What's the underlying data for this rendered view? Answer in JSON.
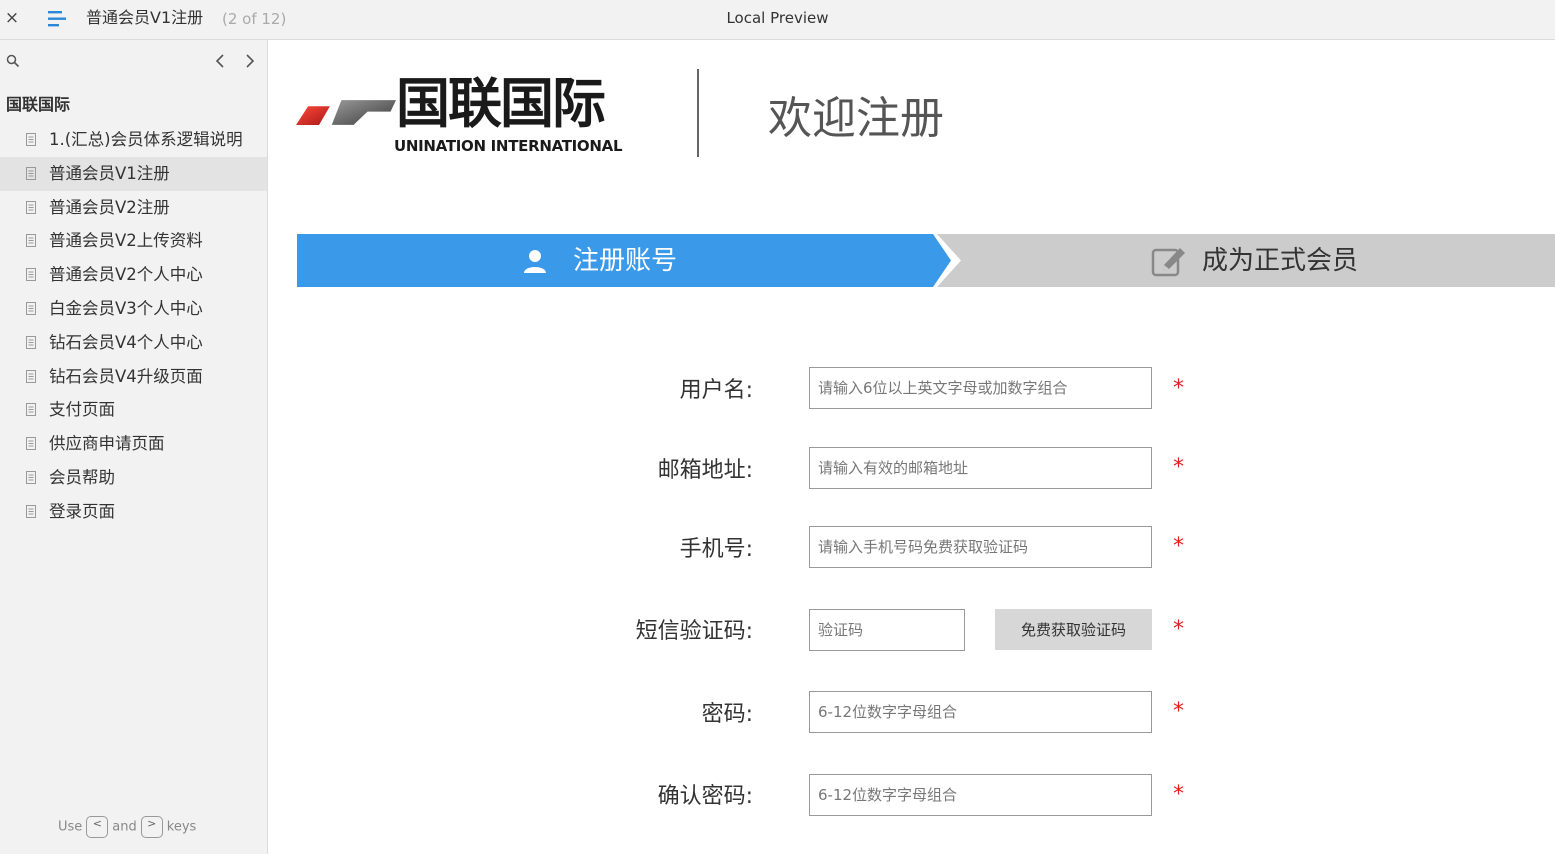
{
  "topbar": {
    "close": "×",
    "page_title": "普通会员V1注册",
    "page_count": "(2 of 12)",
    "preview_label": "Local Preview"
  },
  "sidebar": {
    "root_label": "国联国际",
    "items": [
      {
        "label": "1.(汇总)会员体系逻辑说明",
        "active": false
      },
      {
        "label": "普通会员V1注册",
        "active": true
      },
      {
        "label": "普通会员V2注册",
        "active": false
      },
      {
        "label": "普通会员V2上传资料",
        "active": false
      },
      {
        "label": "普通会员V2个人中心",
        "active": false
      },
      {
        "label": "白金会员V3个人中心",
        "active": false
      },
      {
        "label": "钻石会员V4个人中心",
        "active": false
      },
      {
        "label": "钻石会员V4升级页面",
        "active": false
      },
      {
        "label": "支付页面",
        "active": false
      },
      {
        "label": "供应商申请页面",
        "active": false
      },
      {
        "label": "会员帮助",
        "active": false
      },
      {
        "label": "登录页面",
        "active": false
      }
    ],
    "hint": {
      "use": "Use",
      "key_prev": "<",
      "and": "and",
      "key_next": ">",
      "keys": "keys"
    }
  },
  "header": {
    "logo_cn": "国联国际",
    "logo_en": "UNINATION INTERNATIONAL",
    "welcome": "欢迎注册"
  },
  "steps": {
    "step1": "注册账号",
    "step2": "成为正式会员"
  },
  "form": {
    "username": {
      "label": "用户名:",
      "placeholder": "请输入6位以上英文字母或加数字组合"
    },
    "email": {
      "label": "邮箱地址:",
      "placeholder": "请输入有效的邮箱地址"
    },
    "phone": {
      "label": "手机号:",
      "placeholder": "请输入手机号码免费获取验证码"
    },
    "sms": {
      "label": "短信验证码:",
      "placeholder": "验证码",
      "button": "免费获取验证码"
    },
    "password": {
      "label": "密码:",
      "placeholder": "6-12位数字字母组合"
    },
    "confirm": {
      "label": "确认密码:",
      "placeholder": "6-12位数字字母组合"
    },
    "required_mark": "*"
  },
  "colors": {
    "step_active": "#3b99ea",
    "step_inactive": "#cccccc",
    "required": "#e02020",
    "logo_red": "#d42a2a"
  }
}
